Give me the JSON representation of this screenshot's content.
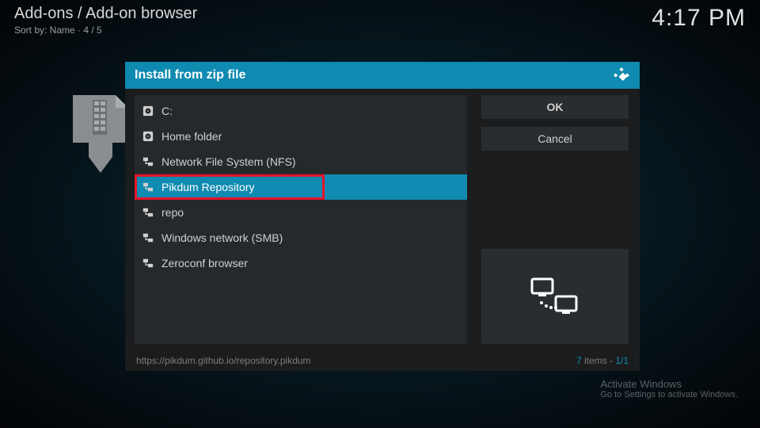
{
  "header": {
    "breadcrumb": "Add-ons / Add-on browser",
    "sortline": "Sort by: Name  ·  4 / 5",
    "clock": "4:17 PM"
  },
  "dialog": {
    "title": "Install from zip file",
    "buttons": {
      "ok": "OK",
      "cancel": "Cancel"
    },
    "items": [
      {
        "icon": "drive",
        "label": "C:"
      },
      {
        "icon": "drive",
        "label": "Home folder"
      },
      {
        "icon": "network",
        "label": "Network File System (NFS)"
      },
      {
        "icon": "network",
        "label": "Pikdum Repository",
        "selected": true,
        "highlight": true
      },
      {
        "icon": "network",
        "label": "repo"
      },
      {
        "icon": "network",
        "label": "Windows network (SMB)"
      },
      {
        "icon": "network",
        "label": "Zeroconf browser"
      }
    ],
    "footer_url": "https://pikdum.github.io/repository.pikdum",
    "footer_count_num": "7",
    "footer_count_word": " items - ",
    "footer_page": "1/1"
  },
  "watermark": {
    "line1": "Activate Windows",
    "line2": "Go to Settings to activate Windows."
  }
}
